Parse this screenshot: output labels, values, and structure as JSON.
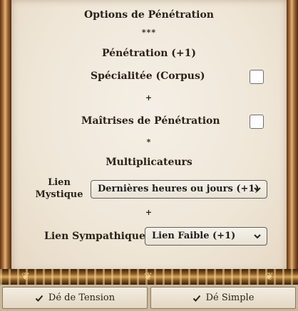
{
  "panel": {
    "title": "Options de Pénétration",
    "separator_1": "***",
    "penetration_label": "Pénétration (+1)",
    "specialty": {
      "label": "Spécialitée (Corpus)",
      "checked": false
    },
    "plus_1": "+",
    "mastery": {
      "label": "Maîtrises de Pénétration",
      "checked": false
    },
    "separator_2": "*",
    "multipliers_heading": "Multiplicateurs",
    "mystic_link": {
      "label_line1": "Lien",
      "label_line2": "Mystique",
      "selected": "Dernières heures ou jours (+1)"
    },
    "plus_2": "+",
    "sympathetic_link": {
      "label": "Lien Sympathique",
      "selected": "Lien Faible (+1)"
    }
  },
  "buttons": {
    "tension_die": "Dé de Tension",
    "simple_die": "Dé Simple"
  },
  "colors": {
    "parchment": "#f1e9dc",
    "frame_gold": "#c08a4c",
    "text": "#2a2118"
  }
}
